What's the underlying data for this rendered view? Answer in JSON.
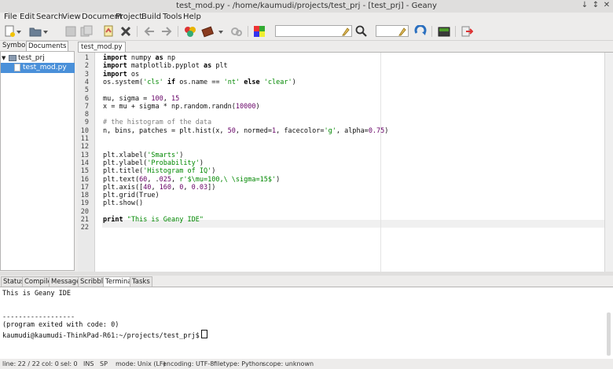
{
  "window": {
    "title": "test_mod.py - /home/kaumudi/projects/test_prj - [test_prj] - Geany",
    "controls": [
      "↓",
      "↕",
      "✕"
    ]
  },
  "menu": [
    "File",
    "Edit",
    "Search",
    "View",
    "Document",
    "Project",
    "Build",
    "Tools",
    "Help"
  ],
  "toolbar": {
    "icons": [
      "new-file-icon",
      "dropdown-icon",
      "open-folder-icon",
      "dropdown-icon",
      "save-icon",
      "save-all-icon",
      "revert-icon",
      "close-icon",
      "back-icon",
      "forward-icon",
      "compile-icon",
      "build-icon",
      "dropdown-icon",
      "run-icon",
      "color-chooser-icon",
      "search-icon",
      "goto-line-icon",
      "terminal-icon",
      "quit-icon"
    ],
    "search_value": "",
    "goto_value": ""
  },
  "sidebar": {
    "tabs": [
      "Symbols",
      "Documents"
    ],
    "active_tab": "Documents",
    "tree": [
      {
        "label": "test_prj"
      },
      {
        "label": "test_mod.py"
      }
    ]
  },
  "editor": {
    "tab_label": "test_mod.py",
    "lines": [
      "import numpy as np",
      "import matplotlib.pyplot as plt",
      "import os",
      "os.system('cls' if os.name == 'nt' else 'clear')",
      "",
      "mu, sigma = 100, 15",
      "x = mu + sigma * np.random.randn(10000)",
      "",
      "# the histogram of the data",
      "n, bins, patches = plt.hist(x, 50, normed=1, facecolor='g', alpha=0.75)",
      "",
      "",
      "plt.xlabel('Smarts')",
      "plt.ylabel('Probability')",
      "plt.title('Histogram of IQ')",
      "plt.text(60, .025, r'$\\mu=100,\\ \\sigma=15$')",
      "plt.axis([40, 160, 0, 0.03])",
      "plt.grid(True)",
      "plt.show()",
      "",
      "print \"This is Geany IDE\"",
      ""
    ]
  },
  "bottom_panel": {
    "tabs": [
      "Status",
      "Compiler",
      "Messages",
      "Scribble",
      "Terminal",
      "Tasks"
    ],
    "active_tab": "Terminal",
    "terminal_lines": [
      "This is Geany IDE",
      "",
      "",
      "------------------",
      "(program exited with code: 0)",
      "kaumudi@kaumudi-ThinkPad-R61:~/projects/test_prj$"
    ]
  },
  "status": {
    "line": "line: 22 / 22",
    "col": "col: 0",
    "sel": "sel: 0",
    "ins": "INS",
    "sp": "SP",
    "mode": "mode: Unix (LF)",
    "encoding": "encoding: UTF-8",
    "filetype": "filetype: Python",
    "scope": "scope: unknown"
  }
}
